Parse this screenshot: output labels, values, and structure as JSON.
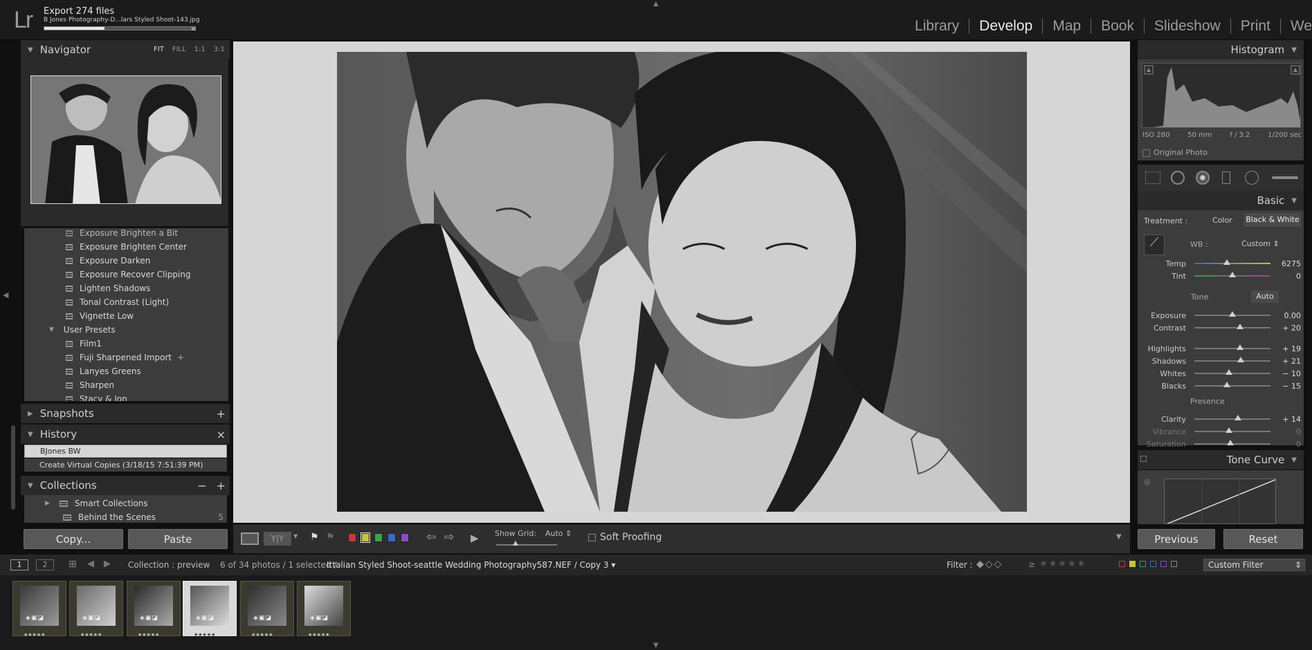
{
  "topbar": {
    "logo": "Lr",
    "export_title": "Export 274 files",
    "export_file": "B Jones Photography-D...lars Styled Shoot-143.jpg",
    "export_progress": 0.4,
    "export_cancel": "×",
    "modules": [
      "Library",
      "Develop",
      "Map",
      "Book",
      "Slideshow",
      "Print",
      "We"
    ],
    "active_module": "Develop"
  },
  "navigator": {
    "title": "Navigator",
    "zoom_options": [
      "FIT",
      "FILL",
      "1:1",
      "3:1"
    ],
    "selected_zoom": "FIT"
  },
  "presets": {
    "items": [
      "Exposure Brighten a Bit",
      "Exposure Brighten Center",
      "Exposure Darken",
      "Exposure Recover Clipping",
      "Lighten Shadows",
      "Tonal Contrast (Light)",
      "Vignette Low"
    ],
    "folder": "User Presets",
    "user_items": [
      "Film1",
      "Fuji Sharpened Import",
      "Lanyes Greens",
      "Sharpen",
      "Stacy & Jon"
    ],
    "fuji_badge": "+"
  },
  "snapshots": {
    "title": "Snapshots",
    "add": "+"
  },
  "history": {
    "title": "History",
    "close": "×",
    "items": [
      "BJones BW",
      "Create Virtual Copies (3/18/15 7:51:39 PM)"
    ]
  },
  "collections": {
    "title": "Collections",
    "minus": "−",
    "plus": "+",
    "items": [
      {
        "label": "Smart Collections",
        "count": ""
      },
      {
        "label": "Behind the Scenes",
        "count": "5"
      }
    ]
  },
  "left_buttons": {
    "copy": "Copy...",
    "paste": "Paste"
  },
  "toolbar": {
    "show_grid_label": "Show Grid:",
    "show_grid_value": "Auto",
    "soft_proofing": "Soft Proofing",
    "yy_label": "Y|Y"
  },
  "histogram": {
    "title": "Histogram",
    "iso": "ISO 280",
    "focal": "50 mm",
    "aperture": "f / 3.2",
    "shutter": "1/200 sec",
    "original_photo": "Original Photo"
  },
  "basic": {
    "title": "Basic",
    "treatment_label": "Treatment :",
    "treatment_color": "Color",
    "treatment_bw": "Black & White",
    "wb_label": "WB :",
    "wb_value": "Custom",
    "tone_label": "Tone",
    "auto_label": "Auto",
    "presence_label": "Presence",
    "sliders": [
      {
        "label": "Temp",
        "value": "6275",
        "pos": 0.43
      },
      {
        "label": "Tint",
        "value": "0",
        "pos": 0.5
      },
      {
        "label": "Exposure",
        "value": "0.00",
        "pos": 0.5
      },
      {
        "label": "Contrast",
        "value": "+ 20",
        "pos": 0.6
      },
      {
        "label": "Highlights",
        "value": "+ 19",
        "pos": 0.6
      },
      {
        "label": "Shadows",
        "value": "+ 21",
        "pos": 0.61
      },
      {
        "label": "Whites",
        "value": "− 10",
        "pos": 0.45
      },
      {
        "label": "Blacks",
        "value": "− 15",
        "pos": 0.43
      },
      {
        "label": "Clarity",
        "value": "+ 14",
        "pos": 0.57
      },
      {
        "label": "Vibrance",
        "value": "0",
        "pos": 0.45
      },
      {
        "label": "Saturation",
        "value": "0",
        "pos": 0.47
      }
    ]
  },
  "tone_curve": {
    "title": "Tone Curve"
  },
  "right_buttons": {
    "previous": "Previous",
    "reset": "Reset"
  },
  "filmstrip_bar": {
    "page1": "1",
    "page2": "2",
    "collection": "Collection : preview",
    "count": "6 of 34 photos / 1 selected /",
    "filename": "Ittalian Styled Shoot-seattle Wedding Photography587.NEF / Copy 3",
    "filter_label": "Filter :",
    "custom_filter": "Custom Filter",
    "rating_op": "≥"
  },
  "thumbnails": [
    {
      "stars": "★★★★★",
      "selected": false
    },
    {
      "stars": "★★★★★",
      "selected": false
    },
    {
      "stars": "★★★★★",
      "selected": false
    },
    {
      "stars": "★★★★★",
      "selected": true
    },
    {
      "stars": "★★★★★",
      "selected": false
    },
    {
      "stars": "★★★★★",
      "selected": false
    }
  ],
  "colors": {
    "bg": "#101010",
    "panel": "#3c3c3c",
    "header": "#2a2a2a",
    "label_red": "#c23a3a",
    "label_yellow": "#c9c23a",
    "label_green": "#3aa24a",
    "label_blue": "#3a6ac9",
    "label_purple": "#8a4ac9"
  }
}
